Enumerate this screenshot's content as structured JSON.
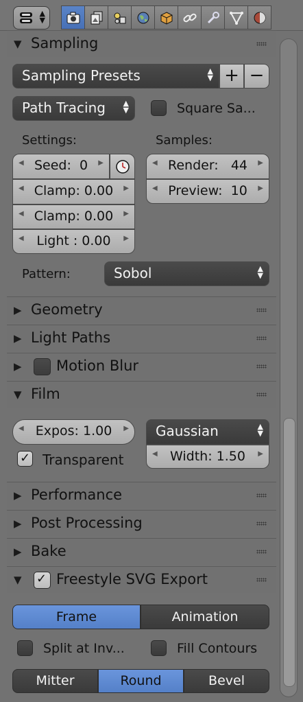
{
  "header": {
    "editor_type_icon": "properties-editor-icon",
    "tabs": [
      {
        "icon": "camera-render-icon",
        "active": true
      },
      {
        "icon": "render-layers-icon",
        "active": false
      },
      {
        "icon": "scene-icon",
        "active": false
      },
      {
        "icon": "world-icon",
        "active": false
      },
      {
        "icon": "object-icon",
        "active": false
      },
      {
        "icon": "constraints-icon",
        "active": false
      },
      {
        "icon": "modifiers-wrench-icon",
        "active": false
      },
      {
        "icon": "object-data-icon",
        "active": false
      },
      {
        "icon": "material-icon",
        "active": false
      }
    ]
  },
  "sampling": {
    "title": "Sampling",
    "presets_label": "Sampling Presets",
    "add_symbol": "+",
    "remove_symbol": "−",
    "integrator": "Path Tracing",
    "square_samples_label": "Square Sa...",
    "settings_label": "Settings:",
    "samples_label": "Samples:",
    "seed_label": "Seed:",
    "seed_value": "0",
    "clamp_direct": "Clamp: 0.00",
    "clamp_indirect": "Clamp: 0.00",
    "light": "Light :  0.00",
    "render_label": "Render:",
    "render_value": "44",
    "preview_label": "Preview:",
    "preview_value": "10",
    "pattern_label": "Pattern:",
    "pattern_value": "Sobol"
  },
  "panels": {
    "geometry": "Geometry",
    "light_paths": "Light Paths",
    "motion_blur": "Motion Blur",
    "film": "Film",
    "performance": "Performance",
    "post_processing": "Post Processing",
    "bake": "Bake",
    "freestyle": "Freestyle SVG Export"
  },
  "film": {
    "exposure": "Expos:  1.00",
    "transparent_label": "Transparent",
    "transparent_checked": true,
    "filter_type": "Gaussian",
    "width": "Width:  1.50"
  },
  "freestyle": {
    "checked": true,
    "mode_options": [
      "Frame",
      "Animation"
    ],
    "mode_selected": "Frame",
    "split_label": "Split at Inv...",
    "fill_label": "Fill Contours",
    "join_options": [
      "Mitter",
      "Round",
      "Bevel"
    ],
    "join_selected": "Round"
  },
  "colors": {
    "accent": "#5480c8",
    "panel_bg": "#727272",
    "field_dark": "#3a3a3a",
    "field_light": "#b8b8b8"
  }
}
